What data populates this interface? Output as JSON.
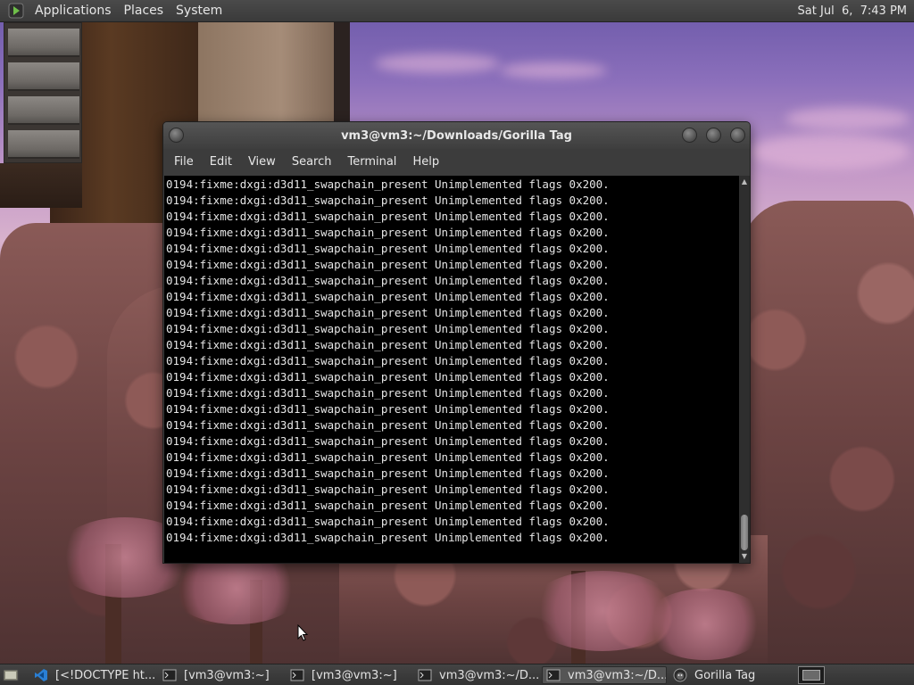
{
  "top_panel": {
    "menus": [
      "Applications",
      "Places",
      "System"
    ],
    "clock": "Sat Jul  6,  7:43 PM",
    "logo_icon": "gnome-foot-icon"
  },
  "terminal": {
    "title": "vm3@vm3:~/Downloads/Gorilla Tag",
    "menu": [
      "File",
      "Edit",
      "View",
      "Search",
      "Terminal",
      "Help"
    ],
    "lines": [
      "0194:fixme:dxgi:d3d11_swapchain_present Unimplemented flags 0x200.",
      "0194:fixme:dxgi:d3d11_swapchain_present Unimplemented flags 0x200.",
      "0194:fixme:dxgi:d3d11_swapchain_present Unimplemented flags 0x200.",
      "0194:fixme:dxgi:d3d11_swapchain_present Unimplemented flags 0x200.",
      "0194:fixme:dxgi:d3d11_swapchain_present Unimplemented flags 0x200.",
      "0194:fixme:dxgi:d3d11_swapchain_present Unimplemented flags 0x200.",
      "0194:fixme:dxgi:d3d11_swapchain_present Unimplemented flags 0x200.",
      "0194:fixme:dxgi:d3d11_swapchain_present Unimplemented flags 0x200.",
      "0194:fixme:dxgi:d3d11_swapchain_present Unimplemented flags 0x200.",
      "0194:fixme:dxgi:d3d11_swapchain_present Unimplemented flags 0x200.",
      "0194:fixme:dxgi:d3d11_swapchain_present Unimplemented flags 0x200.",
      "0194:fixme:dxgi:d3d11_swapchain_present Unimplemented flags 0x200.",
      "0194:fixme:dxgi:d3d11_swapchain_present Unimplemented flags 0x200.",
      "0194:fixme:dxgi:d3d11_swapchain_present Unimplemented flags 0x200.",
      "0194:fixme:dxgi:d3d11_swapchain_present Unimplemented flags 0x200.",
      "0194:fixme:dxgi:d3d11_swapchain_present Unimplemented flags 0x200.",
      "0194:fixme:dxgi:d3d11_swapchain_present Unimplemented flags 0x200.",
      "0194:fixme:dxgi:d3d11_swapchain_present Unimplemented flags 0x200.",
      "0194:fixme:dxgi:d3d11_swapchain_present Unimplemented flags 0x200.",
      "0194:fixme:dxgi:d3d11_swapchain_present Unimplemented flags 0x200.",
      "0194:fixme:dxgi:d3d11_swapchain_present Unimplemented flags 0x200.",
      "0194:fixme:dxgi:d3d11_swapchain_present Unimplemented flags 0x200.",
      "0194:fixme:dxgi:d3d11_swapchain_present Unimplemented flags 0x200."
    ],
    "background": "#000000",
    "foreground": "#e6e6e6"
  },
  "taskbar": {
    "tasks": [
      {
        "label": "[<!DOCTYPE ht...",
        "icon": "vscode-icon",
        "active": false
      },
      {
        "label": "[vm3@vm3:~]",
        "icon": "terminal-icon",
        "active": false
      },
      {
        "label": "[vm3@vm3:~]",
        "icon": "terminal-icon",
        "active": false
      },
      {
        "label": "vm3@vm3:~/D...",
        "icon": "terminal-icon",
        "active": false
      },
      {
        "label": "vm3@vm3:~/D...",
        "icon": "terminal-icon",
        "active": true
      },
      {
        "label": "Gorilla Tag",
        "icon": "gorilla-icon",
        "active": false
      }
    ]
  }
}
